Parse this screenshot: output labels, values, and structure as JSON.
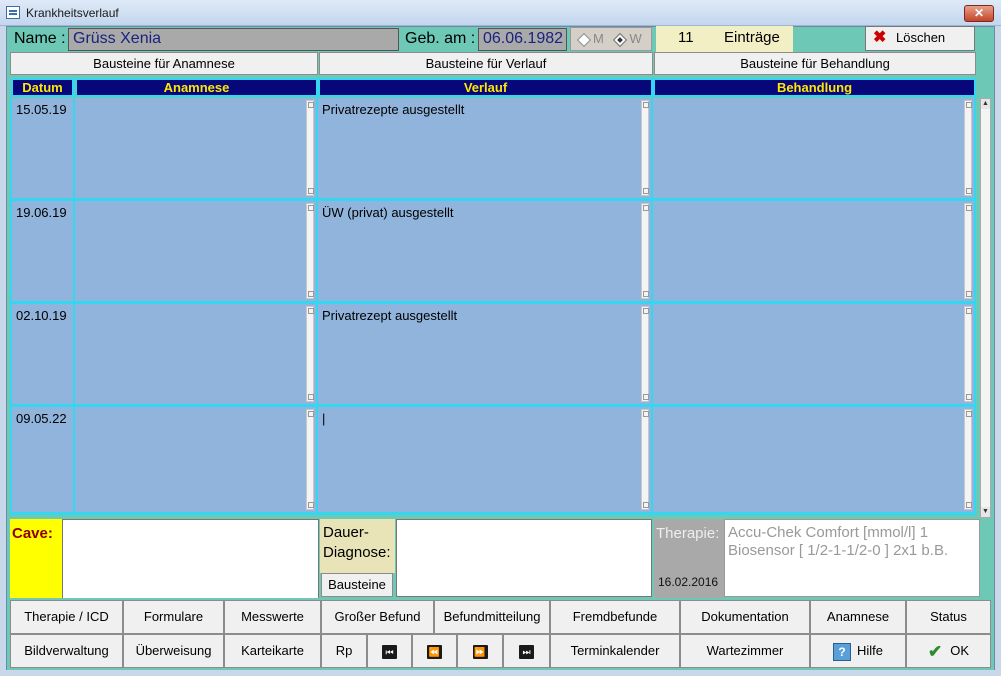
{
  "window": {
    "title": "Krankheitsverlauf",
    "close_label": "✕"
  },
  "patient": {
    "name_label": "Name :",
    "name_value": "Grüss Xenia",
    "birth_label": "Geb. am :",
    "birth_value": "06.06.1982",
    "sex_options": [
      "M",
      "W"
    ],
    "sex_selected": "W"
  },
  "entries": {
    "count": "11",
    "label": "Einträge"
  },
  "toolbar": {
    "delete_label": "Löschen"
  },
  "bausteine_buttons": [
    "Bausteine für Anamnese",
    "Bausteine für Verlauf",
    "Bausteine für Behandlung"
  ],
  "columns": [
    "Datum",
    "Anamnese",
    "Verlauf",
    "Behandlung"
  ],
  "rows": [
    {
      "date": "15.05.19",
      "anamnese": "",
      "verlauf": "Privatrezepte ausgestellt",
      "behandlung": ""
    },
    {
      "date": "19.06.19",
      "anamnese": "",
      "verlauf": "ÜW (privat) ausgestellt",
      "behandlung": ""
    },
    {
      "date": "02.10.19",
      "anamnese": "",
      "verlauf": "Privatrezept ausgestellt",
      "behandlung": ""
    },
    {
      "date": "09.05.22",
      "anamnese": "",
      "verlauf": "|",
      "behandlung": ""
    }
  ],
  "info": {
    "cave_label": "Cave:",
    "cave_value": "",
    "dauer_label_1": "Dauer-",
    "dauer_label_2": "Diagnose:",
    "dauer_value": "",
    "bausteine_label": "Bausteine",
    "therapie_label": "Therapie:",
    "therapie_date": "16.02.2016",
    "therapie_line_1": "Accu-Chek Comfort [mmol/l] 1",
    "therapie_line_2": "Biosensor [ 1/2-1-1/2-0 ] 2x1 b.B."
  },
  "nav_row_1": [
    "Therapie / ICD",
    "Formulare",
    "Messwerte",
    "Großer Befund",
    "Befundmitteilung",
    "Fremdbefunde",
    "Dokumentation",
    "Anamnese",
    "Status"
  ],
  "nav_row_2": {
    "bildverwaltung": "Bildverwaltung",
    "ueberweisung": "Überweisung",
    "karteikarte": "Karteikarte",
    "rp": "Rp",
    "first_icon": "⏮",
    "prev_icon": "⏪",
    "next_icon": "⏩",
    "last_icon": "⏭",
    "terminkalender": "Terminkalender",
    "wartezimmer": "Wartezimmer",
    "hilfe": "Hilfe",
    "ok": "OK"
  },
  "icons": {
    "app": "notebook-icon",
    "delete": "red-x-icon",
    "help": "question-icon",
    "ok": "checkmark-icon"
  },
  "colors": {
    "frame": "#6dc8b6",
    "header_bg": "#07077a",
    "header_text": "#ffe800",
    "grid_line": "#35d6f0",
    "cell_bg": "#91b4dc",
    "cave_bg": "#ffff00"
  }
}
